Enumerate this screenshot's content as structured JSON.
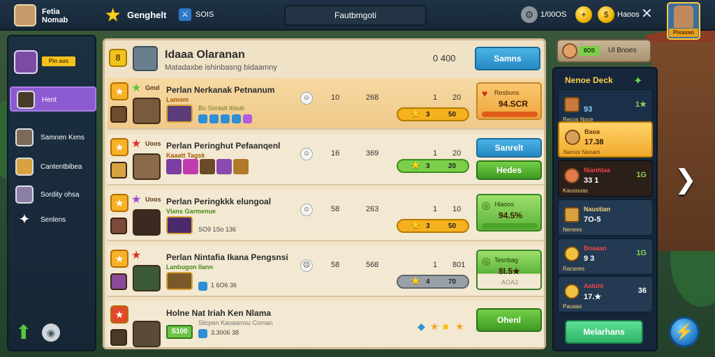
{
  "colors": {
    "accent_purple": "#8c5ad0",
    "panel_bg": "#efe2c6",
    "blue_btn": "#2589c2",
    "green_btn": "#3f9a24",
    "gold": "#f3c31c"
  },
  "topbar": {
    "player_name": "Fetia Nomab",
    "title": "Genghelt",
    "title_icon": "star-icon",
    "sub_label": "SOIS",
    "center_banner": "Fautbmgoti",
    "gear_value": "1/00OS",
    "coin_value": "Haoos",
    "profile_label": "Pixasan"
  },
  "sidebar": {
    "top_tag": "Pin aus",
    "items": [
      {
        "label": "Hent",
        "icon": "ninja-icon",
        "active": true
      },
      {
        "label": "Samnen Kens",
        "icon": "warrior-icon"
      },
      {
        "label": "Cantentbibea",
        "icon": "soldier-icon"
      },
      {
        "label": "Sordity ohsa",
        "icon": "wizard-icon"
      },
      {
        "label": "Senlens",
        "icon": "sparkle-icon"
      }
    ]
  },
  "main": {
    "header": {
      "badge": "8",
      "title": "Idaaa Olaranan",
      "subtitle": "Matadaxbe ishinbasng bidaamny",
      "value": "0 400",
      "button": "Samns"
    },
    "rows": [
      {
        "tier_tag": "Gmd",
        "tier_star": "★",
        "title": "Perlan Nerkanak Petnanum",
        "sub": "Lamom",
        "caption": "Bu Sorasti Itioub",
        "stat1": "10",
        "stat2": "268",
        "stat3": "1",
        "stat4": "20",
        "pill_left": "3",
        "pill_right": "50",
        "pill_style": "gold",
        "action_line1": "Resbuns",
        "action_line2": "94.SCR"
      },
      {
        "tier_tag": "Uoos",
        "tier_star": "★",
        "title": "Perlan Peringhut Pefaanqenl",
        "sub": "Kaaatt Tagsk",
        "caption": "",
        "stat1": "16",
        "stat2": "369",
        "stat3": "1",
        "stat4": "20",
        "pill_left": "3",
        "pill_right": "20",
        "pill_style": "green",
        "btn1": "Sanrelt",
        "btn2": "Hedes"
      },
      {
        "tier_tag": "Uoos",
        "tier_star": "★",
        "title": "Perlan Peringkkk elungoal",
        "sub": "Vlans Garmenue",
        "caption": "SO9 1So 136",
        "stat1": "58",
        "stat2": "263",
        "stat3": "1",
        "stat4": "10",
        "pill_left": "3",
        "pill_right": "50",
        "pill_style": "gold",
        "action_line1": "Hlaoos",
        "action_line2": "94.5%"
      },
      {
        "tier_tag": "",
        "tier_star": "★",
        "title": "Perlan Nintafia Ikana Pengsnsi",
        "sub": "Lanbugon Ilann",
        "caption": "1 6O6 36",
        "stat1": "58",
        "stat2": "568",
        "stat3": "1",
        "stat4": "801",
        "pill_left": "4",
        "pill_right": "70",
        "pill_style": "gray",
        "action_line1": "Tesnbag",
        "action_line2": "8I.5★",
        "action_line3": "AOA3"
      },
      {
        "tier_tag": "",
        "tier_star": "",
        "title": "Holne Nat Iriah Ken Nlama",
        "sub": "Slicpen Kaoaamsu Coman",
        "caption": "3.3006 38",
        "tag": "S100",
        "btn1": "Ohenl"
      }
    ]
  },
  "right_panel": {
    "top_tag": "8OS",
    "top_text": "Ul Bnoes",
    "title": "Nenoe Deck",
    "cards": [
      {
        "label1": "",
        "label2": "93",
        "label3": "Recos Noce",
        "right": "1★"
      },
      {
        "label1": "Baoa",
        "label2": "17.38",
        "label3": "Nernor Nenam",
        "right": "",
        "active": true
      },
      {
        "label1": "Nianhtaa",
        "label2": "33 1",
        "label3": "Kauoouas",
        "right": "1G"
      },
      {
        "label1": "Naustian",
        "label2": "7O-5",
        "label3": "Nenees",
        "right": ""
      },
      {
        "label1": "Boaaan",
        "label2": "9 3",
        "label3": "Racaves",
        "right": "1G"
      },
      {
        "label1": "Aalunt",
        "label2": "17.★",
        "label3": "Pauaas",
        "right": "36"
      }
    ],
    "button": "Melarhans"
  }
}
